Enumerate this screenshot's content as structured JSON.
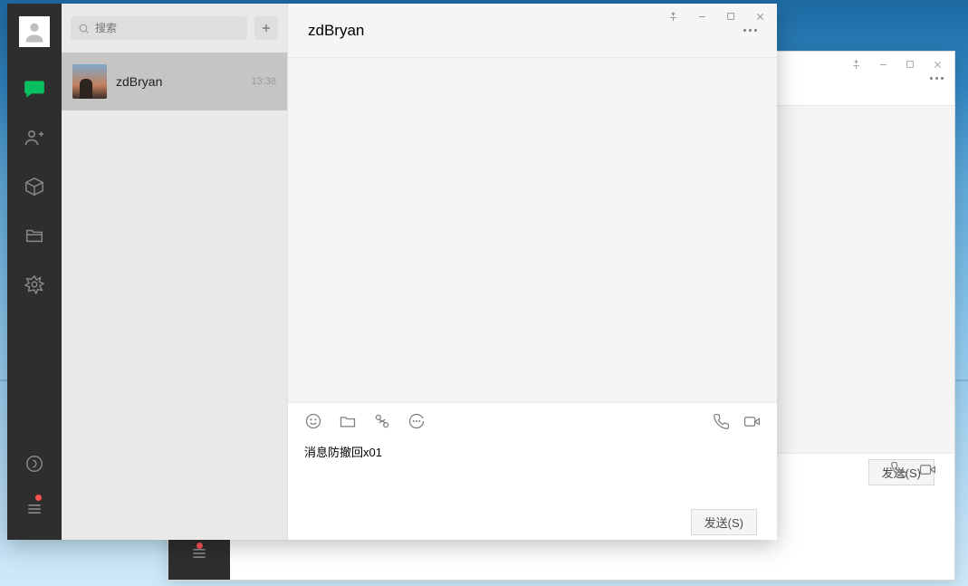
{
  "search": {
    "placeholder": "搜索"
  },
  "conversations": [
    {
      "name": "zdBryan",
      "time": "13:38"
    }
  ],
  "chat": {
    "title": "zdBryan",
    "input_text": "消息防撤回x01",
    "send_label": "发送(S)"
  },
  "window2": {
    "send_label": "发送(S)"
  },
  "icons": {
    "chat": "chat-bubble",
    "contacts": "contacts",
    "cube": "collect",
    "folder": "files",
    "component": "mini-program",
    "music": "music",
    "menu": "menu"
  }
}
